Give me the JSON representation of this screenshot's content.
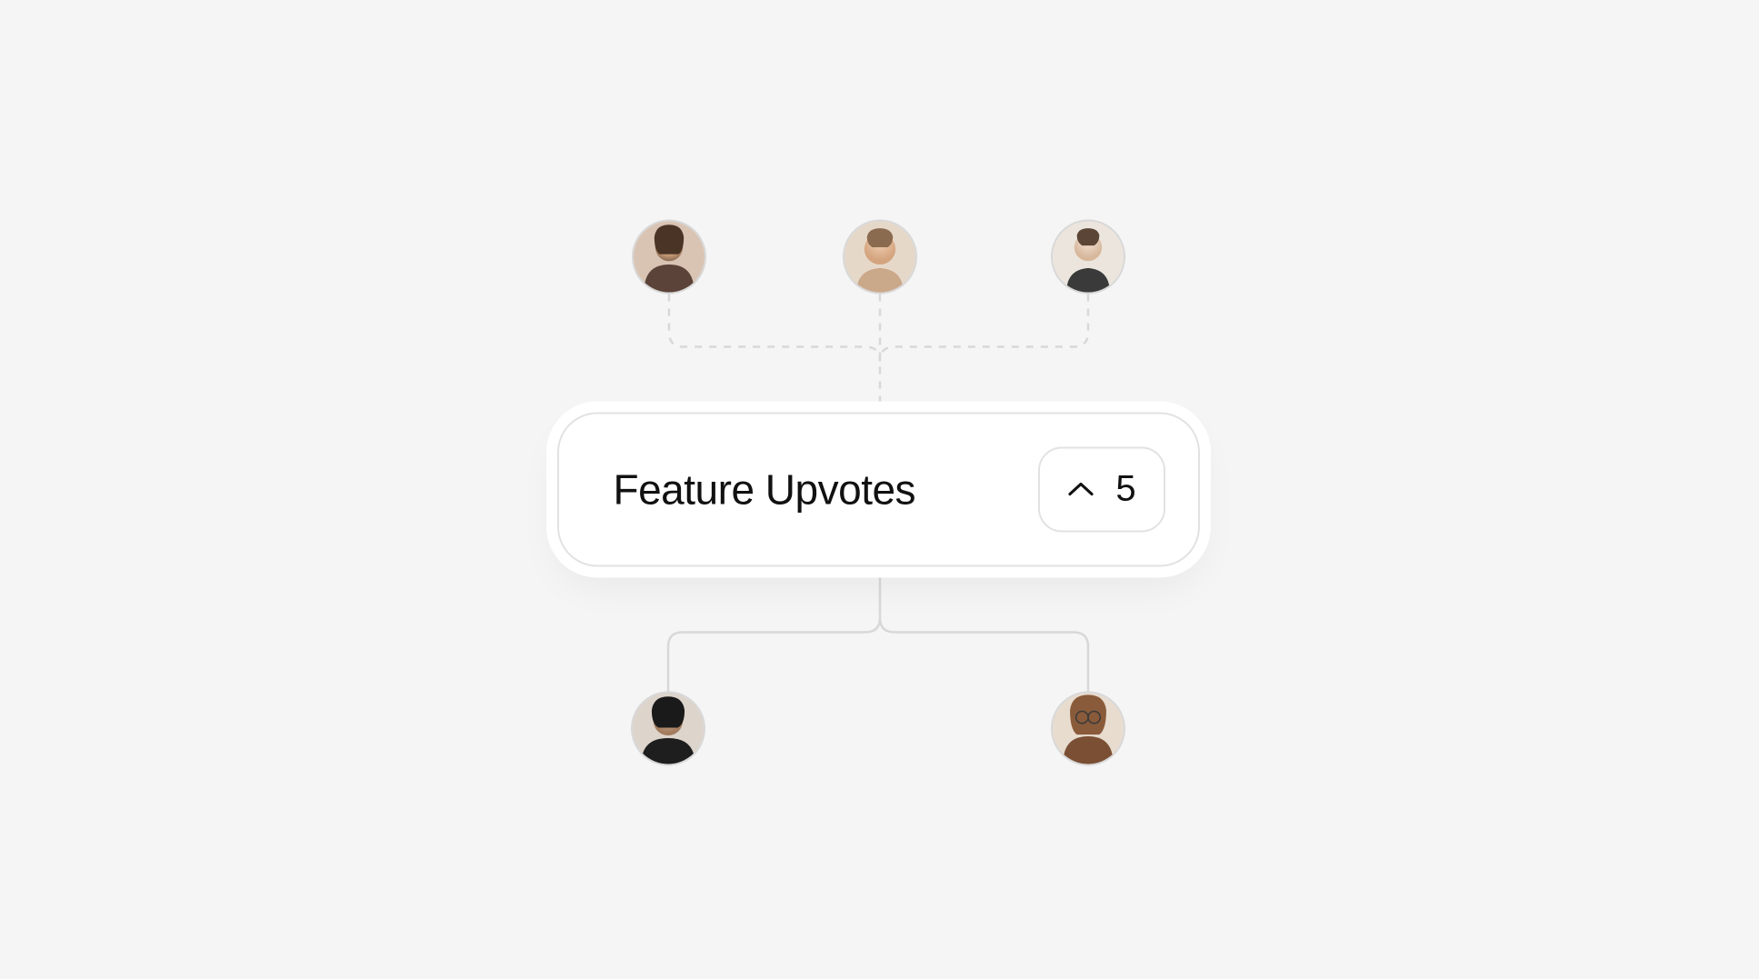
{
  "card": {
    "title": "Feature Upvotes",
    "upvote_count": "5"
  },
  "avatars": {
    "top": [
      {
        "name": "user-avatar-1"
      },
      {
        "name": "user-avatar-2"
      },
      {
        "name": "user-avatar-3"
      }
    ],
    "bottom": [
      {
        "name": "user-avatar-4"
      },
      {
        "name": "user-avatar-5"
      }
    ]
  },
  "colors": {
    "background": "#f5f5f5",
    "card_bg": "#ffffff",
    "border": "#e2e2e2",
    "line": "#d8d8d8",
    "text": "#111111"
  }
}
